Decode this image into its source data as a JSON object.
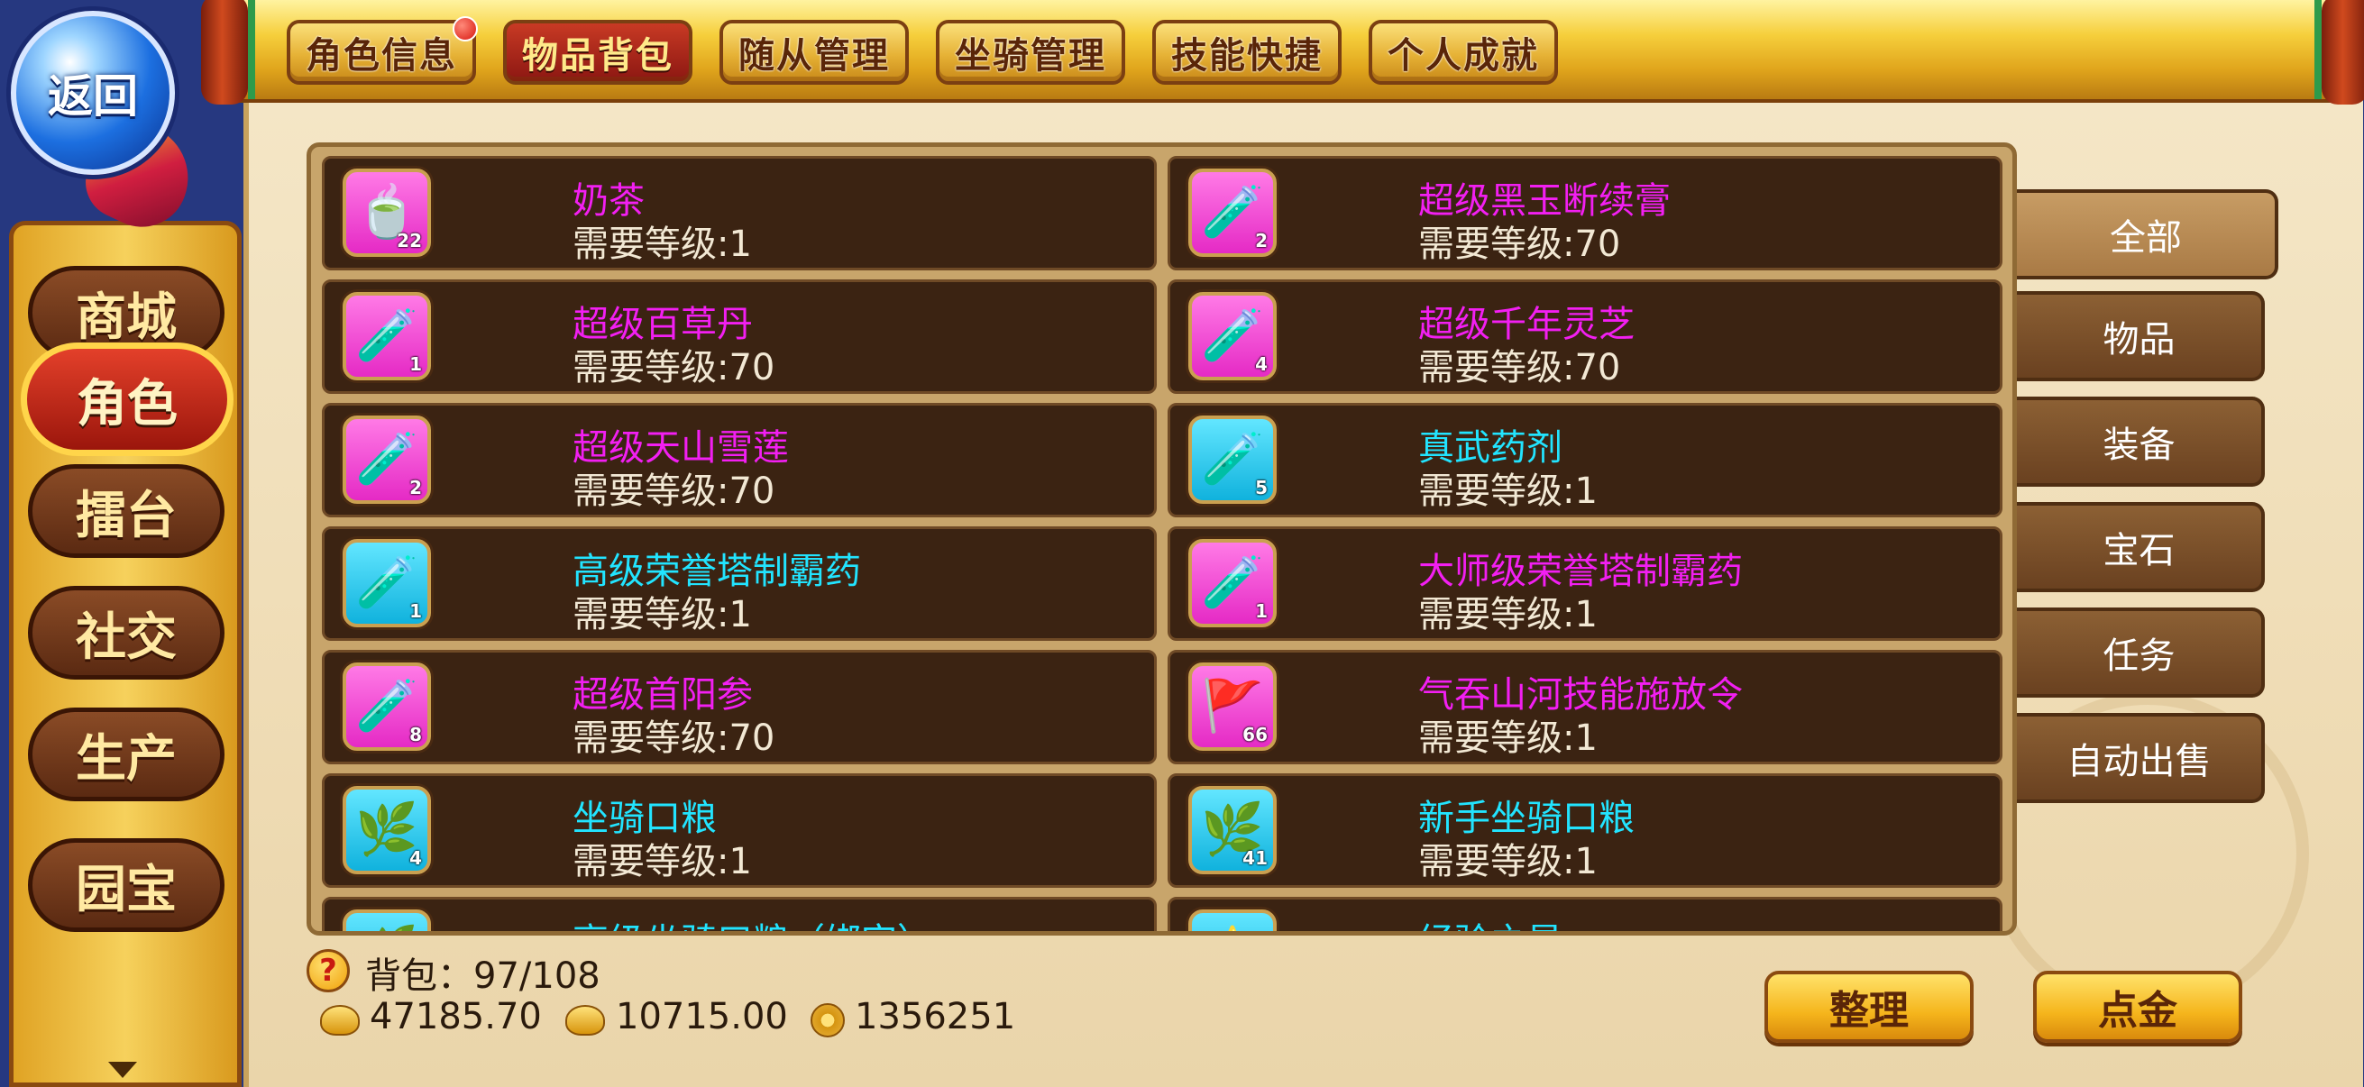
{
  "back_button": {
    "label": "返回"
  },
  "top_tabs": [
    {
      "label": "角色信息",
      "badge": true
    },
    {
      "label": "物品背包",
      "active": true
    },
    {
      "label": "随从管理"
    },
    {
      "label": "坐骑管理"
    },
    {
      "label": "技能快捷"
    },
    {
      "label": "个人成就"
    }
  ],
  "sidebar": {
    "items": [
      {
        "label": "商城"
      },
      {
        "label": "角色",
        "active": true
      },
      {
        "label": "擂台"
      },
      {
        "label": "社交"
      },
      {
        "label": "生产"
      },
      {
        "label": "园宝"
      }
    ]
  },
  "inventory": {
    "items": [
      {
        "name": "奶茶",
        "req": "需要等级:1",
        "qty": "22",
        "name_color": "pink",
        "icon_bg": "pink",
        "icon": "teacup-icon"
      },
      {
        "name": "超级黑玉断续膏",
        "req": "需要等级:70",
        "qty": "2",
        "name_color": "pink",
        "icon_bg": "pink",
        "icon": "potion-red-icon"
      },
      {
        "name": "超级百草丹",
        "req": "需要等级:70",
        "qty": "1",
        "name_color": "pink",
        "icon_bg": "pink",
        "icon": "potion-red-icon"
      },
      {
        "name": "超级千年灵芝",
        "req": "需要等级:70",
        "qty": "4",
        "name_color": "pink",
        "icon_bg": "pink",
        "icon": "potion-blue-icon"
      },
      {
        "name": "超级天山雪莲",
        "req": "需要等级:70",
        "qty": "2",
        "name_color": "pink",
        "icon_bg": "pink",
        "icon": "potion-blue-icon"
      },
      {
        "name": "真武药剂",
        "req": "需要等级:1",
        "qty": "5",
        "name_color": "cyan",
        "icon_bg": "cyan",
        "icon": "potion-green-icon"
      },
      {
        "name": "高级荣誉塔制霸药",
        "req": "需要等级:1",
        "qty": "1",
        "name_color": "cyan",
        "icon_bg": "cyan",
        "icon": "potion-green-icon"
      },
      {
        "name": "大师级荣誉塔制霸药",
        "req": "需要等级:1",
        "qty": "1",
        "name_color": "pink",
        "icon_bg": "pink",
        "icon": "potion-green-icon"
      },
      {
        "name": "超级首阳参",
        "req": "需要等级:70",
        "qty": "8",
        "name_color": "pink",
        "icon_bg": "pink",
        "icon": "potion-green-icon"
      },
      {
        "name": "气吞山河技能施放令",
        "req": "需要等级:1",
        "qty": "66",
        "name_color": "pink",
        "icon_bg": "pink",
        "icon": "flag-token-icon"
      },
      {
        "name": "坐骑口粮",
        "req": "需要等级:1",
        "qty": "4",
        "name_color": "cyan",
        "icon_bg": "cyan",
        "icon": "grass-feed-icon"
      },
      {
        "name": "新手坐骑口粮",
        "req": "需要等级:1",
        "qty": "41",
        "name_color": "cyan",
        "icon_bg": "cyan",
        "icon": "grass-feed-icon"
      },
      {
        "name": "高级坐骑口粮（绑定）",
        "req": "",
        "qty": "",
        "name_color": "cyan",
        "icon_bg": "cyan",
        "icon": "grass-feed-icon"
      },
      {
        "name": "经验之星",
        "req": "",
        "qty": "",
        "name_color": "cyan",
        "icon_bg": "cyan",
        "icon": "star-icon"
      }
    ]
  },
  "categories": [
    {
      "label": "全部",
      "active": true
    },
    {
      "label": "物品"
    },
    {
      "label": "装备"
    },
    {
      "label": "宝石"
    },
    {
      "label": "任务"
    },
    {
      "label": "自动出售"
    }
  ],
  "footer": {
    "bag_label": "背包：97/108",
    "gold": "47185.70",
    "bound_gold": "10715.00",
    "coins": "1356251",
    "sort_label": "整理",
    "topup_label": "点金"
  },
  "colors": {
    "pink_text": "#f21ff2",
    "cyan_text": "#22e4ff",
    "cell_bg": "#3b2312"
  }
}
